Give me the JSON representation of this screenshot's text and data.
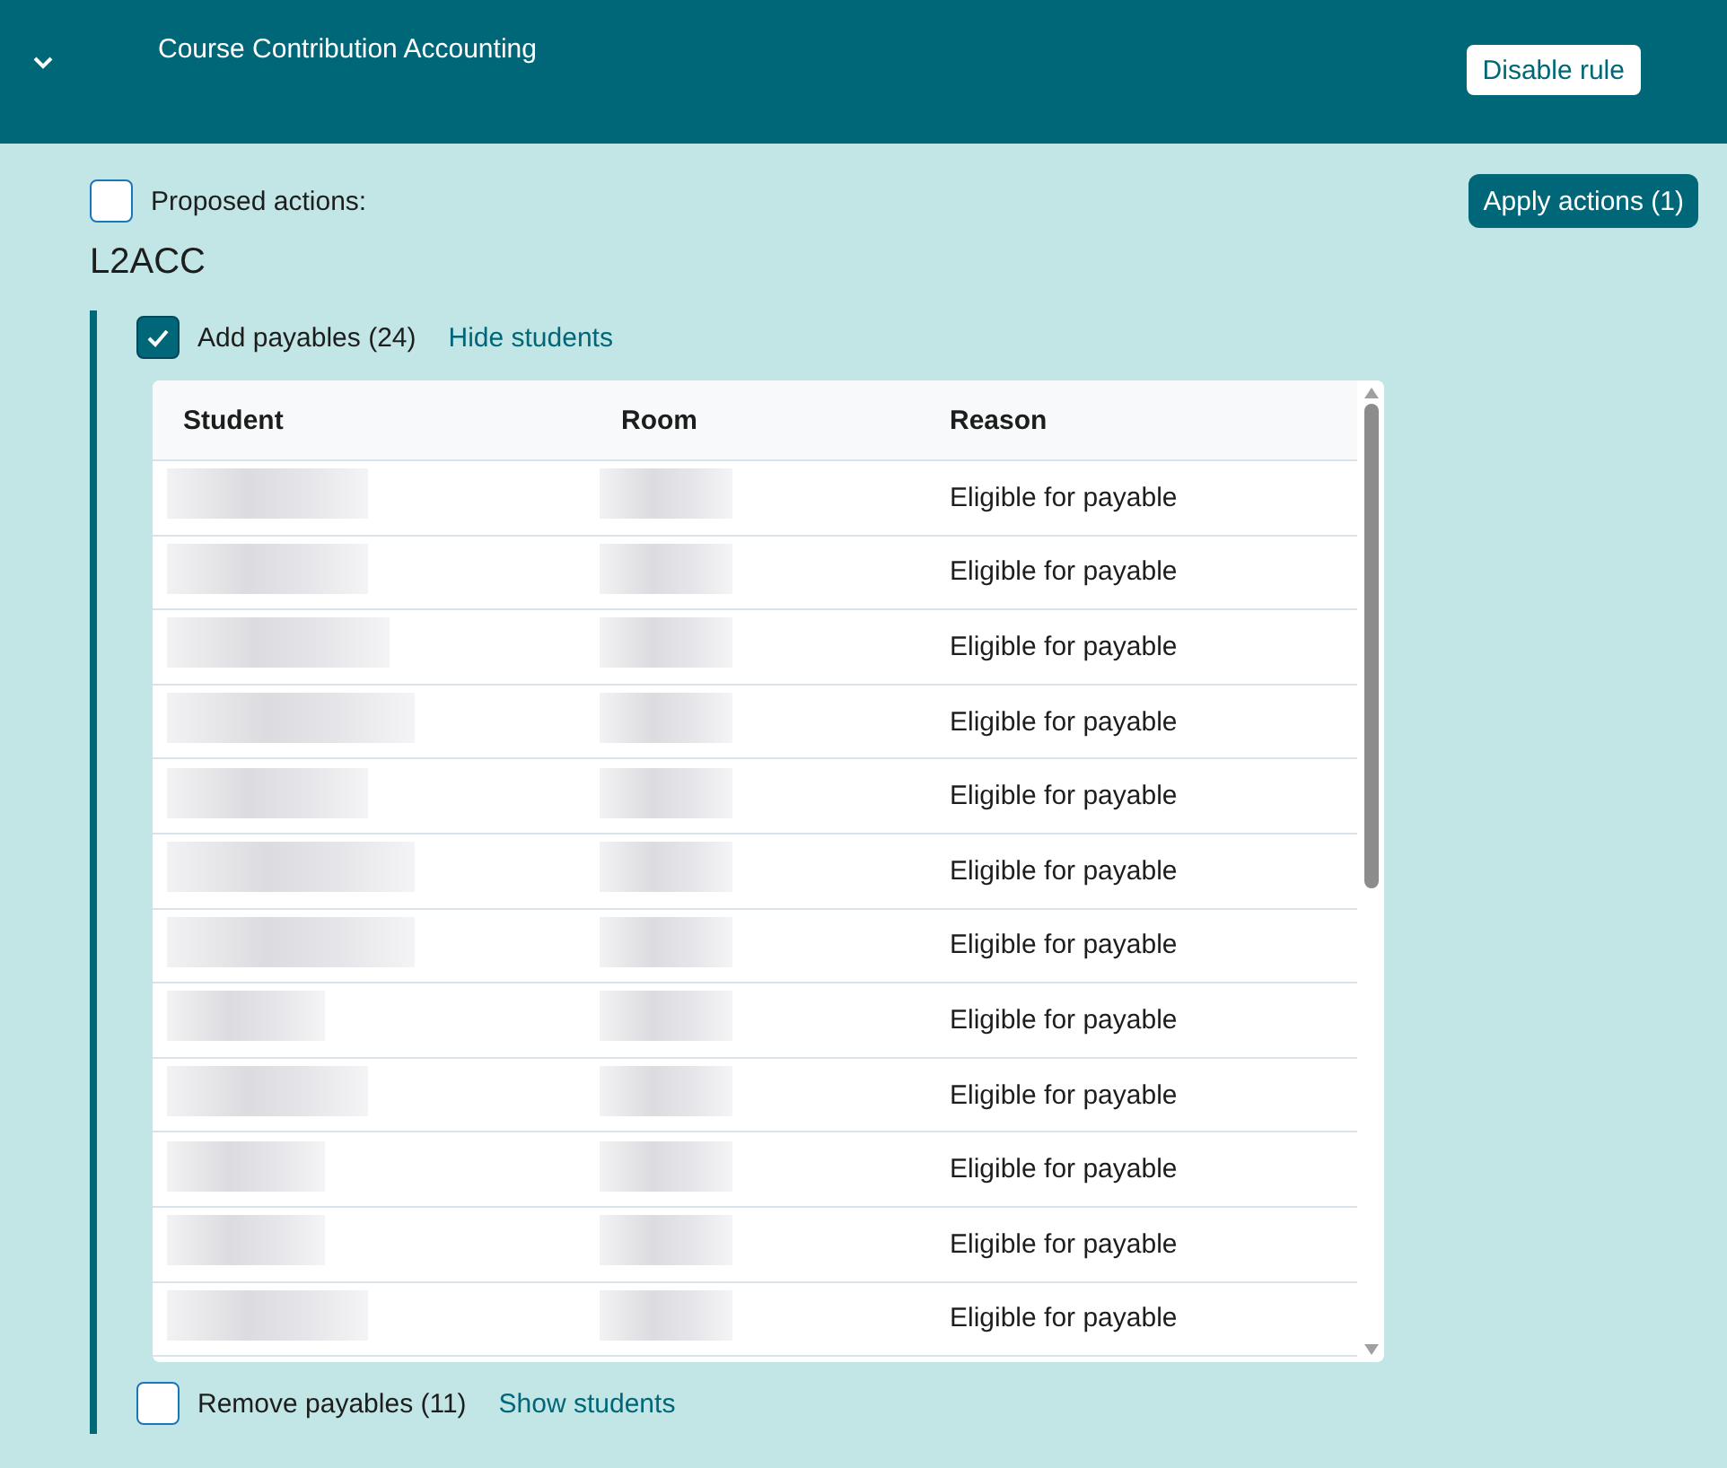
{
  "header": {
    "title": "Course Contribution Accounting",
    "expanded": true,
    "button": "Disable rule"
  },
  "proposed": {
    "label": "Proposed actions:",
    "checked": false,
    "button": "Apply actions (1)"
  },
  "group": {
    "title": "L2ACC",
    "actions": [
      {
        "label": "Add payables (24)",
        "checked": true,
        "link": "Hide students",
        "table": {
          "columns": [
            "Student",
            "Room",
            "Reason"
          ],
          "rows": [
            {
              "reason": "Eligible for payable"
            },
            {
              "reason": "Eligible for payable"
            },
            {
              "reason": "Eligible for payable"
            },
            {
              "reason": "Eligible for payable"
            },
            {
              "reason": "Eligible for payable"
            },
            {
              "reason": "Eligible for payable"
            },
            {
              "reason": "Eligible for payable"
            },
            {
              "reason": "Eligible for payable"
            },
            {
              "reason": "Eligible for payable"
            },
            {
              "reason": "Eligible for payable"
            },
            {
              "reason": "Eligible for payable"
            },
            {
              "reason": "Eligible for payable"
            }
          ]
        }
      },
      {
        "label": "Remove payables (11)",
        "checked": false,
        "link": "Show students"
      }
    ]
  }
}
